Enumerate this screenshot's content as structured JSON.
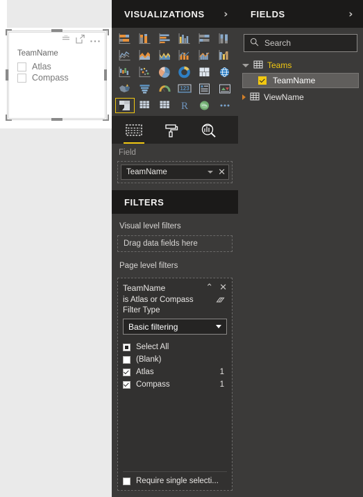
{
  "canvas": {
    "visual": {
      "type": "slicer",
      "title": "TeamName",
      "header_icons": [
        "filter-sort-icon",
        "focus-mode-icon",
        "more-options-icon"
      ],
      "items": [
        {
          "label": "Atlas",
          "checked": false
        },
        {
          "label": "Compass",
          "checked": false
        }
      ]
    }
  },
  "visualizations": {
    "header": "VISUALIZATIONS",
    "collapse_glyph": "›",
    "icons": [
      {
        "name": "stacked-bar-chart",
        "row": 1
      },
      {
        "name": "stacked-column-chart",
        "row": 1
      },
      {
        "name": "clustered-bar-chart",
        "row": 1
      },
      {
        "name": "clustered-column-chart",
        "row": 1
      },
      {
        "name": "100-stacked-bar-chart",
        "row": 1
      },
      {
        "name": "100-stacked-column-chart",
        "row": 1
      },
      {
        "name": "line-chart",
        "row": 2
      },
      {
        "name": "area-chart",
        "row": 2
      },
      {
        "name": "stacked-area-chart",
        "row": 2
      },
      {
        "name": "line-and-stacked-column-chart",
        "row": 2
      },
      {
        "name": "line-and-clustered-column-chart",
        "row": 2
      },
      {
        "name": "ribbon-chart",
        "row": 2
      },
      {
        "name": "waterfall-chart",
        "row": 3
      },
      {
        "name": "scatter-chart",
        "row": 3
      },
      {
        "name": "pie-chart",
        "row": 3
      },
      {
        "name": "donut-chart",
        "row": 3
      },
      {
        "name": "treemap-chart",
        "row": 3
      },
      {
        "name": "map-chart",
        "row": 3
      },
      {
        "name": "filled-map-chart",
        "row": 4
      },
      {
        "name": "funnel-chart",
        "row": 4
      },
      {
        "name": "gauge-chart",
        "row": 4
      },
      {
        "name": "card-visual",
        "row": 4
      },
      {
        "name": "multi-row-card-visual",
        "row": 4
      },
      {
        "name": "kpi-visual",
        "row": 4
      },
      {
        "name": "slicer-visual",
        "row": 5,
        "selected": true
      },
      {
        "name": "table-visual",
        "row": 5
      },
      {
        "name": "matrix-visual",
        "row": 5
      },
      {
        "name": "r-script-visual",
        "row": 5
      },
      {
        "name": "arcgis-map-visual",
        "row": 5
      },
      {
        "name": "more-visuals",
        "row": 5
      }
    ],
    "tabs": [
      {
        "name": "fields-tab",
        "active": true
      },
      {
        "name": "format-tab",
        "active": false
      },
      {
        "name": "analytics-tab",
        "active": false
      }
    ],
    "field_well": {
      "label": "Field",
      "chip": "TeamName"
    }
  },
  "filters": {
    "header": "FILTERS",
    "visual_level_title": "Visual level filters",
    "visual_level_dropzone": "Drag data fields here",
    "page_level_title": "Page level filters",
    "card": {
      "field_name": "TeamName",
      "condition": "is Atlas or Compass",
      "filter_type_label": "Filter Type",
      "filter_type_value": "Basic filtering",
      "collapse_glyph": "⌃",
      "close_glyph": "✕",
      "clear_icon": "eraser-icon",
      "items": [
        {
          "label": "Select All",
          "state": "partial",
          "count": ""
        },
        {
          "label": "(Blank)",
          "state": "unchecked",
          "count": ""
        },
        {
          "label": "Atlas",
          "state": "checked",
          "count": "1"
        },
        {
          "label": "Compass",
          "state": "checked",
          "count": "1"
        }
      ],
      "require_single_selection": "Require single selecti...",
      "require_single_selection_checked": false
    }
  },
  "fields": {
    "header": "FIELDS",
    "collapse_glyph": "›",
    "search_placeholder": "Search",
    "tree": [
      {
        "name": "Teams",
        "expanded": true,
        "highlighted": true
      },
      {
        "name": "ViewName",
        "expanded": false,
        "highlighted": false
      }
    ],
    "selected_field": {
      "name": "TeamName",
      "checked": true
    }
  },
  "colors": {
    "accent_yellow": "#f2c811",
    "panel_dark": "#252423",
    "panel_body": "#3b3a39",
    "header_dark": "#1b1a19",
    "card_bg": "#323130"
  }
}
